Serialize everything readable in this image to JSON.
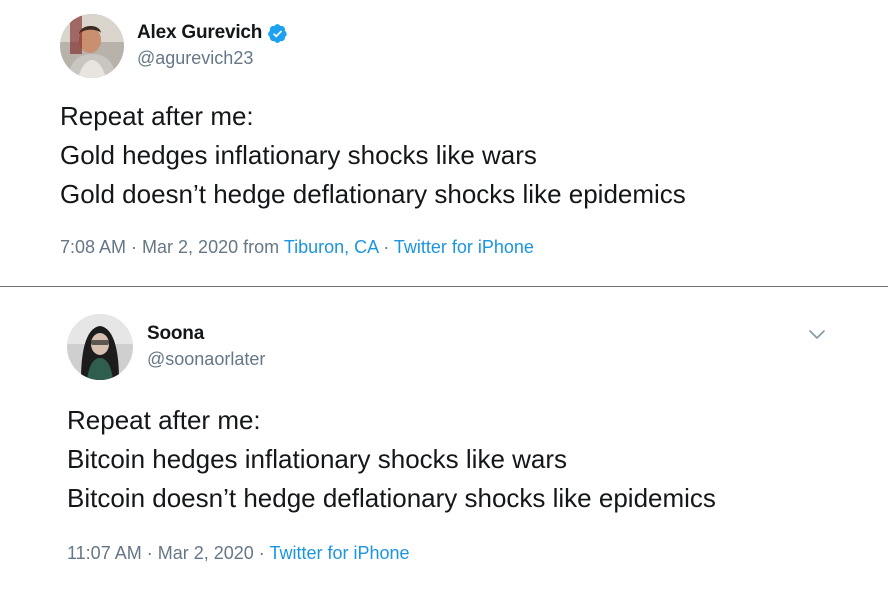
{
  "colors": {
    "text": "#14171a",
    "secondary": "#657786",
    "link": "#1b95e0",
    "divider": "#6b6f74",
    "verified": "#1da1f2"
  },
  "tweets": [
    {
      "author": {
        "display_name": "Alex Gurevich",
        "handle": "@agurevich23",
        "verified": true,
        "avatar_icon": "profile-photo"
      },
      "lines": [
        "Repeat after me:",
        "Gold hedges inflationary shocks like wars",
        "Gold doesn’t hedge deflationary shocks like epidemics"
      ],
      "time": "7:08 AM",
      "date": "Mar 2, 2020",
      "from_label": "from",
      "location": "Tiburon, CA",
      "source": "Twitter for iPhone"
    },
    {
      "author": {
        "display_name": "Soona",
        "handle": "@soonaorlater",
        "verified": false,
        "avatar_icon": "profile-photo"
      },
      "lines": [
        "Repeat after me:",
        "Bitcoin hedges inflationary shocks like wars",
        "Bitcoin doesn’t hedge deflationary shocks like epidemics"
      ],
      "time": "11:07 AM",
      "date": "Mar 2, 2020",
      "source": "Twitter for iPhone",
      "menu_icon": "chevron-down-icon"
    }
  ],
  "separator": " · "
}
